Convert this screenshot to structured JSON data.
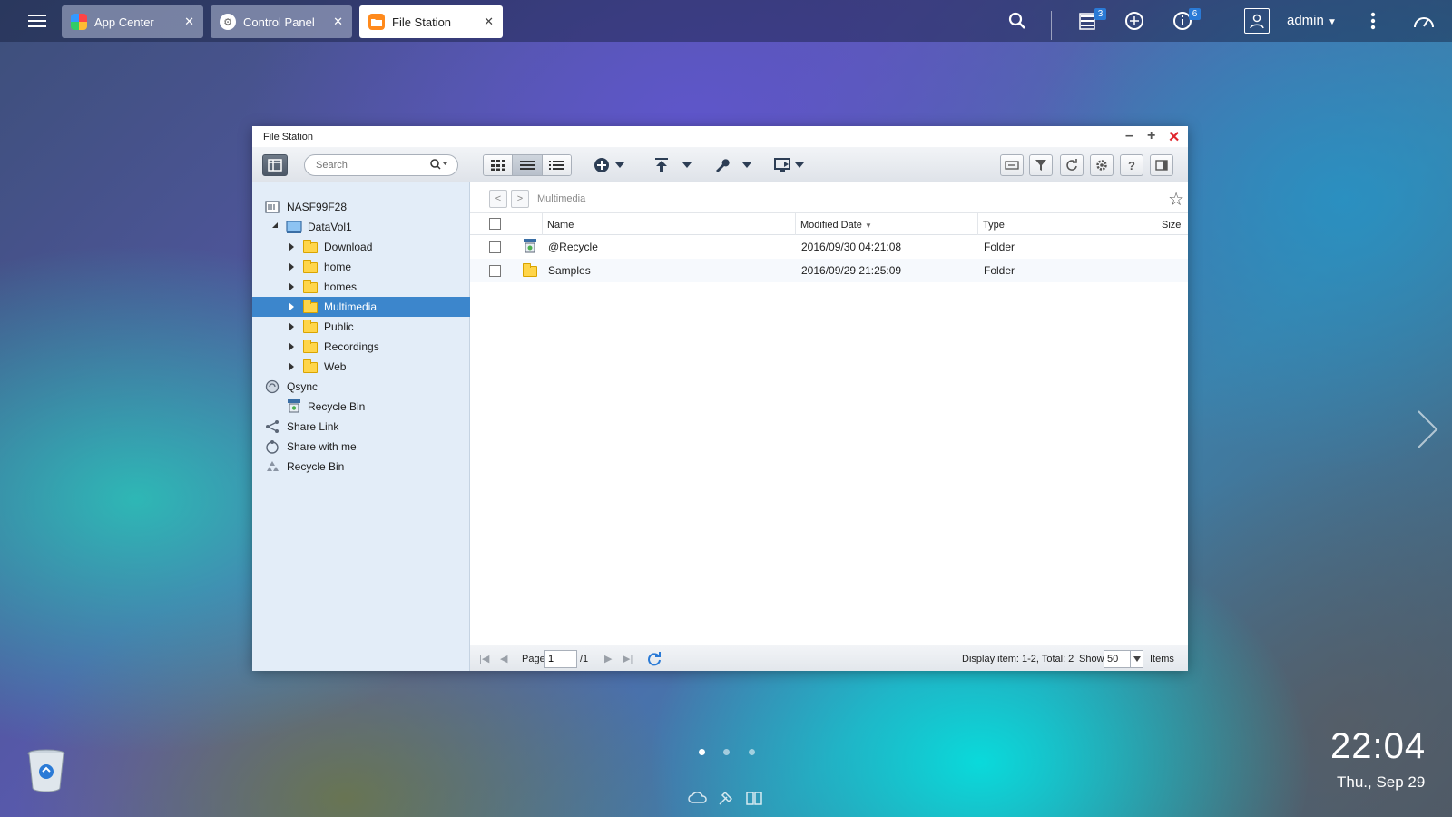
{
  "taskbar": {
    "tabs": [
      {
        "label": "App Center",
        "icon": "app-center-icon"
      },
      {
        "label": "Control Panel",
        "icon": "gear-icon"
      },
      {
        "label": "File Station",
        "icon": "folder-icon"
      }
    ],
    "active_tab": "File Station",
    "notifications_badge": "3",
    "info_badge": "6",
    "user": "admin"
  },
  "window": {
    "title": "File Station",
    "search_placeholder": "Search",
    "path": "Multimedia"
  },
  "tree": [
    {
      "label": "NASF99F28",
      "icon": "server-icon",
      "level": 0
    },
    {
      "label": "DataVol1",
      "icon": "volume-icon",
      "level": 1
    },
    {
      "label": "Download",
      "icon": "folder-icon",
      "level": 2
    },
    {
      "label": "home",
      "icon": "folder-icon",
      "level": 2
    },
    {
      "label": "homes",
      "icon": "folder-icon",
      "level": 2
    },
    {
      "label": "Multimedia",
      "icon": "folder-icon",
      "level": 2,
      "selected": true
    },
    {
      "label": "Public",
      "icon": "folder-icon",
      "level": 2
    },
    {
      "label": "Recordings",
      "icon": "folder-icon",
      "level": 2
    },
    {
      "label": "Web",
      "icon": "folder-icon",
      "level": 2
    },
    {
      "label": "Qsync",
      "icon": "qsync-icon",
      "level": 0
    },
    {
      "label": "Recycle Bin",
      "icon": "recycle-bin-icon",
      "level": 1
    },
    {
      "label": "Share Link",
      "icon": "share-icon",
      "level": 0
    },
    {
      "label": "Share with me",
      "icon": "share-with-me-icon",
      "level": 0
    },
    {
      "label": "Recycle Bin",
      "icon": "recycle-icon",
      "level": 0
    }
  ],
  "grid": {
    "columns": [
      "Name",
      "Modified Date",
      "Type",
      "Size"
    ],
    "rows": [
      {
        "name": "@Recycle",
        "modified": "2016/09/30 04:21:08",
        "type": "Folder",
        "size": ""
      },
      {
        "name": "Samples",
        "modified": "2016/09/29 21:25:09",
        "type": "Folder",
        "size": ""
      }
    ]
  },
  "footer": {
    "page_label": "Page",
    "page_value": "1",
    "page_total": "/1",
    "display_info": "Display item: 1-2, Total: 2",
    "show_label": "Show",
    "show_value": "50",
    "items_label": "Items"
  },
  "clock": {
    "time": "22:04",
    "date": "Thu., Sep 29"
  },
  "colors": {
    "selection": "#3c86cc",
    "badge": "#2a7ad6",
    "close_red": "#e0262d"
  }
}
